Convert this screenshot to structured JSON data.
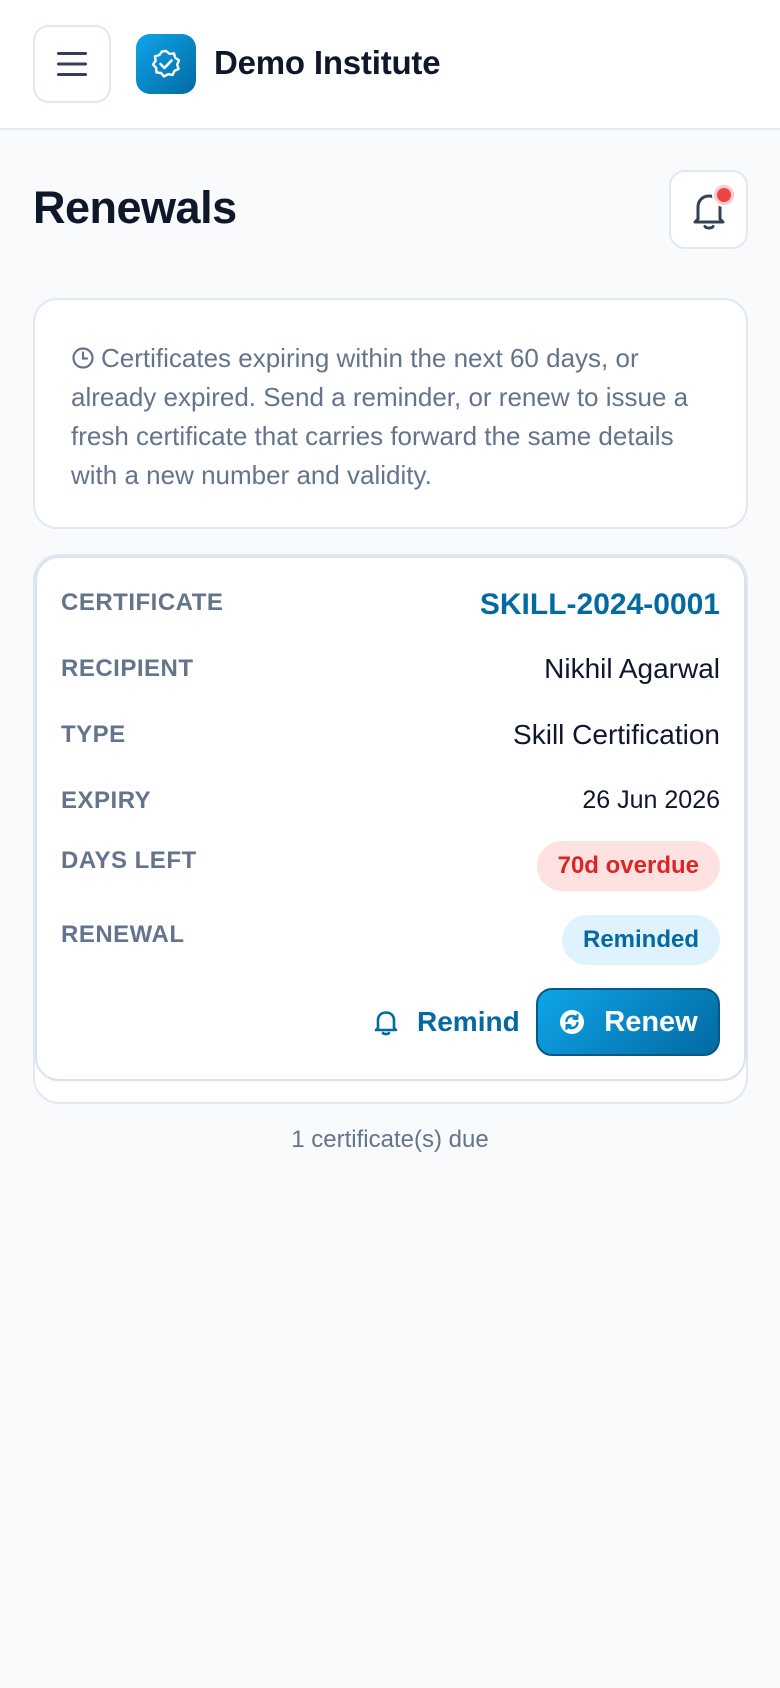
{
  "header": {
    "brand": "Demo Institute",
    "menu_icon": "hamburger-menu-icon",
    "logo_icon": "verified-badge-icon"
  },
  "page": {
    "title": "Renewals",
    "bell_icon": "bell-icon"
  },
  "info": {
    "icon": "clock-icon",
    "text": "Certificates expiring within the next 60 days, or already expired. Send a reminder, or renew to issue a fresh certificate that carries forward the same details with a new number and validity."
  },
  "certificate": {
    "labels": {
      "certificate": "CERTIFICATE",
      "recipient": "RECIPIENT",
      "type": "TYPE",
      "expiry": "EXPIRY",
      "days_left": "DAYS LEFT",
      "renewal": "RENEWAL"
    },
    "id": "SKILL-2024-0001",
    "recipient": "Nikhil Agarwal",
    "type": "Skill Certification",
    "expiry": "26 Jun 2026",
    "days_left": "70d overdue",
    "renewal_status": "Reminded",
    "actions": {
      "remind_label": "Remind",
      "remind_icon": "bell-icon",
      "renew_label": "Renew",
      "renew_icon": "refresh-icon"
    }
  },
  "footer": {
    "count_text": "1 certificate(s) due"
  },
  "colors": {
    "accent": "#0369a1",
    "accent_light": "#0ea5e9",
    "overdue_text": "#dc2626",
    "overdue_bg": "#fee2e2",
    "reminded_bg": "#e0f2fe",
    "muted_text": "#64748b",
    "background": "#f8fafc"
  }
}
